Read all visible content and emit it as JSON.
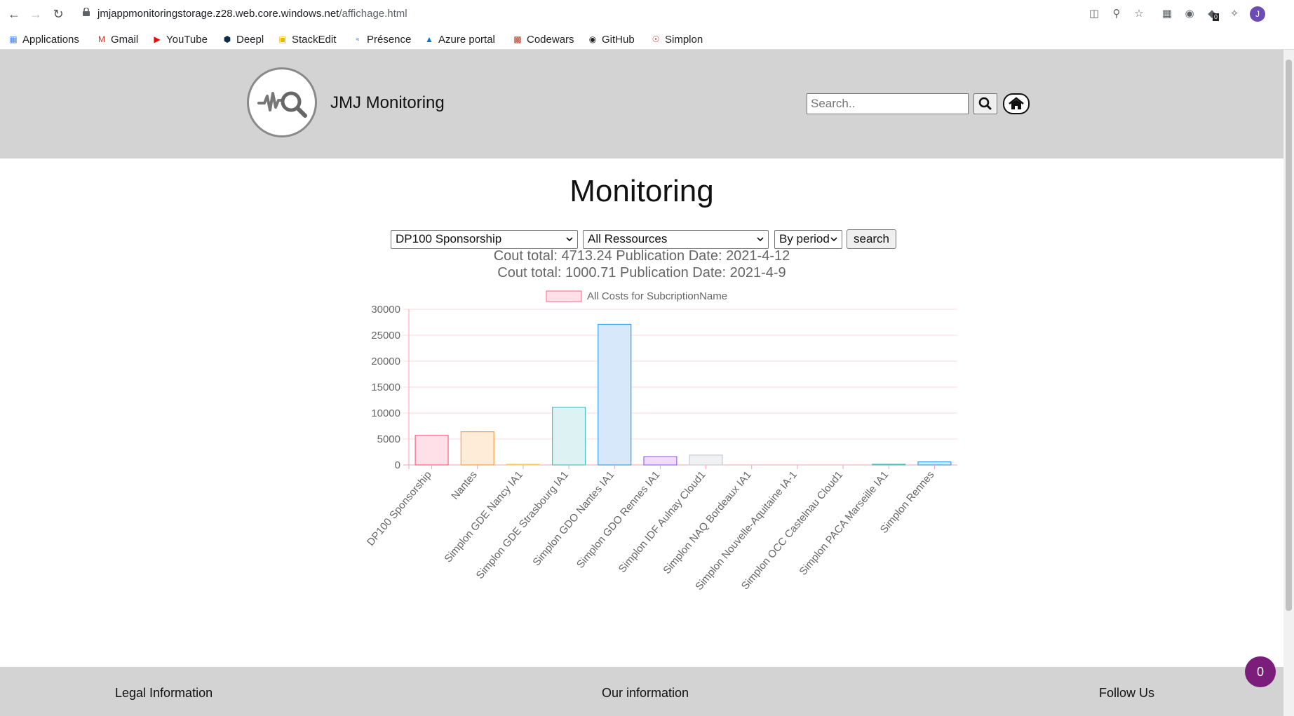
{
  "browser": {
    "url_host": "jmjappmonitoringstorage.z28.web.core.windows.net",
    "url_path": "/affichage.html",
    "profile_initial": "J",
    "extension_badge": "0"
  },
  "bookmarks": [
    "Applications",
    "Gmail",
    "YouTube",
    "Deepl",
    "StackEdit",
    "Présence",
    "Azure portal",
    "Codewars",
    "GitHub",
    "Simplon"
  ],
  "header": {
    "brand": "JMJ Monitoring",
    "search_placeholder": "Search.."
  },
  "main": {
    "title": "Monitoring",
    "subscription_select": "DP100 Sponsorship",
    "resource_select": "All Ressources",
    "period_select": "By period",
    "search_button": "search",
    "totals": [
      "Cout total: 4713.24 Publication Date: 2021-4-12",
      "Cout total: 1000.71 Publication Date: 2021-4-9"
    ]
  },
  "chart_data": {
    "type": "bar",
    "legend": "All Costs for SubcriptionName",
    "categories": [
      "DP100 Sponsorship",
      "Nantes",
      "Simplon GDE Nancy IA1",
      "Simplon GDE Strasbourg IA1",
      "Simplon GDO Nantes IA1",
      "Simplon GDO Rennes IA1",
      "Simplon IDF Aulnay Cloud1",
      "Simplon NAQ Bordeaux IA1",
      "Simplon Nouvelle-Aquitaine IA-1",
      "Simplon OCC Castelnau Cloud1",
      "Simplon PACA Marseille IA1",
      "Simplon Rennes"
    ],
    "values": [
      5700,
      6400,
      100,
      11100,
      27100,
      1600,
      1900,
      0,
      0,
      0,
      100,
      600
    ],
    "ylim": [
      0,
      30000
    ],
    "yticks": [
      "0",
      "5000",
      "10000",
      "15000",
      "20000",
      "25000",
      "30000"
    ],
    "colors": {
      "fills": [
        "#ffe0e8",
        "#ffecd8",
        "#fff5dd",
        "#ddf3f3",
        "#d8e8fb",
        "#f0dcff",
        "#f0f1f3",
        "#ffe0e8",
        "#ffecd8",
        "#fff5dd",
        "#ddf3f3",
        "#d8e8fb"
      ],
      "strokes": [
        "#ff6384",
        "#ff9f40",
        "#ffcd56",
        "#4bc0c0",
        "#36a2eb",
        "#9966ff",
        "#c9cbcf",
        "#ff6384",
        "#ff9f40",
        "#ffcd56",
        "#4bc0c0",
        "#36a2eb"
      ]
    },
    "grid": true
  },
  "footer": {
    "legal": "Legal Information",
    "info": "Our information",
    "follow": "Follow Us"
  },
  "fab_label": "0"
}
